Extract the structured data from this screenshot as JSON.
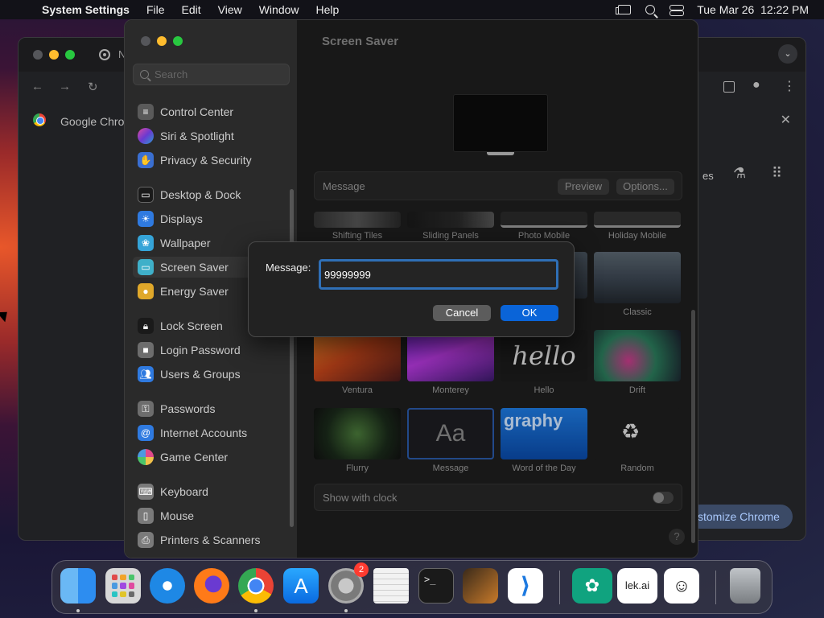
{
  "menubar": {
    "app_name": "System Settings",
    "menus": [
      "File",
      "Edit",
      "View",
      "Window",
      "Help"
    ],
    "clock": "Tue Mar 26  12:22 PM"
  },
  "chrome_window": {
    "tab_title_partial": "N",
    "bookmark_text": "Google Chrom",
    "right_text_partial": "es",
    "customize_label": "stomize Chrome"
  },
  "sidebar": {
    "search_placeholder": "Search",
    "items": [
      {
        "label": "Control Center",
        "icon": "control-center-icon",
        "color": "#5a5a5a"
      },
      {
        "label": "Siri & Spotlight",
        "icon": "siri-icon",
        "color": "#8a3ad1"
      },
      {
        "label": "Privacy & Security",
        "icon": "hand-icon",
        "color": "#3a6fd1"
      },
      {
        "label": "Desktop & Dock",
        "icon": "dock-icon",
        "color": "#2a2a2a"
      },
      {
        "label": "Displays",
        "icon": "sun-icon",
        "color": "#2f7ae0"
      },
      {
        "label": "Wallpaper",
        "icon": "wallpaper-icon",
        "color": "#35a4d8"
      },
      {
        "label": "Screen Saver",
        "icon": "screen-saver-icon",
        "color": "#3fb0c9"
      },
      {
        "label": "Energy Saver",
        "icon": "bulb-icon",
        "color": "#e0a82a"
      },
      {
        "label": "Lock Screen",
        "icon": "lock-icon",
        "color": "#2a2a2a"
      },
      {
        "label": "Login Password",
        "icon": "key-icon",
        "color": "#6d6d6d"
      },
      {
        "label": "Users & Groups",
        "icon": "users-icon",
        "color": "#2f7ae0"
      },
      {
        "label": "Passwords",
        "icon": "key-icon",
        "color": "#6d6d6d"
      },
      {
        "label": "Internet Accounts",
        "icon": "at-icon",
        "color": "#2f7ae0"
      },
      {
        "label": "Game Center",
        "icon": "game-center-icon",
        "color": "#d14a8a"
      },
      {
        "label": "Keyboard",
        "icon": "keyboard-icon",
        "color": "#7a7a7a"
      },
      {
        "label": "Mouse",
        "icon": "mouse-icon",
        "color": "#7a7a7a"
      },
      {
        "label": "Printers & Scanners",
        "icon": "printer-icon",
        "color": "#7a7a7a"
      }
    ],
    "selected": "Screen Saver"
  },
  "content": {
    "title": "Screen Saver",
    "selected_saver_label": "Message",
    "preview_button": "Preview",
    "options_button": "Options...",
    "savers": [
      {
        "label": "Shifting Tiles"
      },
      {
        "label": "Sliding Panels"
      },
      {
        "label": "Photo Mobile"
      },
      {
        "label": "Holiday Mobile"
      },
      {
        "label": "Classic"
      },
      {
        "label": "Ventura"
      },
      {
        "label": "Monterey"
      },
      {
        "label": "Hello",
        "thumb_text": "hello"
      },
      {
        "label": "Drift"
      },
      {
        "label": "Flurry"
      },
      {
        "label": "Message",
        "thumb_text": "Aa"
      },
      {
        "label": "Word of the Day",
        "thumb_text": "graphy"
      },
      {
        "label": "Random"
      }
    ],
    "show_with_clock_label": "Show with clock",
    "show_with_clock_on": false,
    "help_label": "?"
  },
  "dialog": {
    "label": "Message:",
    "value": "99999999",
    "cancel_label": "Cancel",
    "ok_label": "OK"
  },
  "dock": {
    "apps": [
      {
        "name": "Finder",
        "icon": "finder-icon",
        "color": "#2d8df0"
      },
      {
        "name": "Launchpad",
        "icon": "launchpad-icon",
        "color": "#d8d8d8"
      },
      {
        "name": "Safari",
        "icon": "safari-icon",
        "color": "#1e88e5"
      },
      {
        "name": "Firefox",
        "icon": "firefox-icon",
        "color": "#ff7a18"
      },
      {
        "name": "Google Chrome",
        "icon": "chrome-icon",
        "color": "#4285f4"
      },
      {
        "name": "App Store",
        "icon": "app-store-icon",
        "color": "#1a8cff"
      },
      {
        "name": "System Settings",
        "icon": "system-settings-icon",
        "color": "#8a8a8a",
        "badge": "2"
      },
      {
        "name": "TextEdit",
        "icon": "textedit-icon",
        "color": "#f2f2f2"
      },
      {
        "name": "Terminal",
        "icon": "terminal-icon",
        "color": "#1a1a1a"
      },
      {
        "name": "GarageBand",
        "icon": "guitar-icon",
        "color": "#3a2a1a"
      },
      {
        "name": "Visual Studio Code",
        "icon": "vscode-icon",
        "color": "#ffffff"
      },
      {
        "name": "ChatGPT",
        "icon": "chatgpt-icon",
        "color": "#10a37f"
      },
      {
        "name": "lek.ai",
        "icon": "lek-ai-icon",
        "color": "#ffffff",
        "text": "lek.ai"
      },
      {
        "name": "Avatar App",
        "icon": "avatar-icon",
        "color": "#ffffff"
      },
      {
        "name": "Trash",
        "icon": "trash-icon",
        "color": "#9aa0a6"
      }
    ]
  }
}
